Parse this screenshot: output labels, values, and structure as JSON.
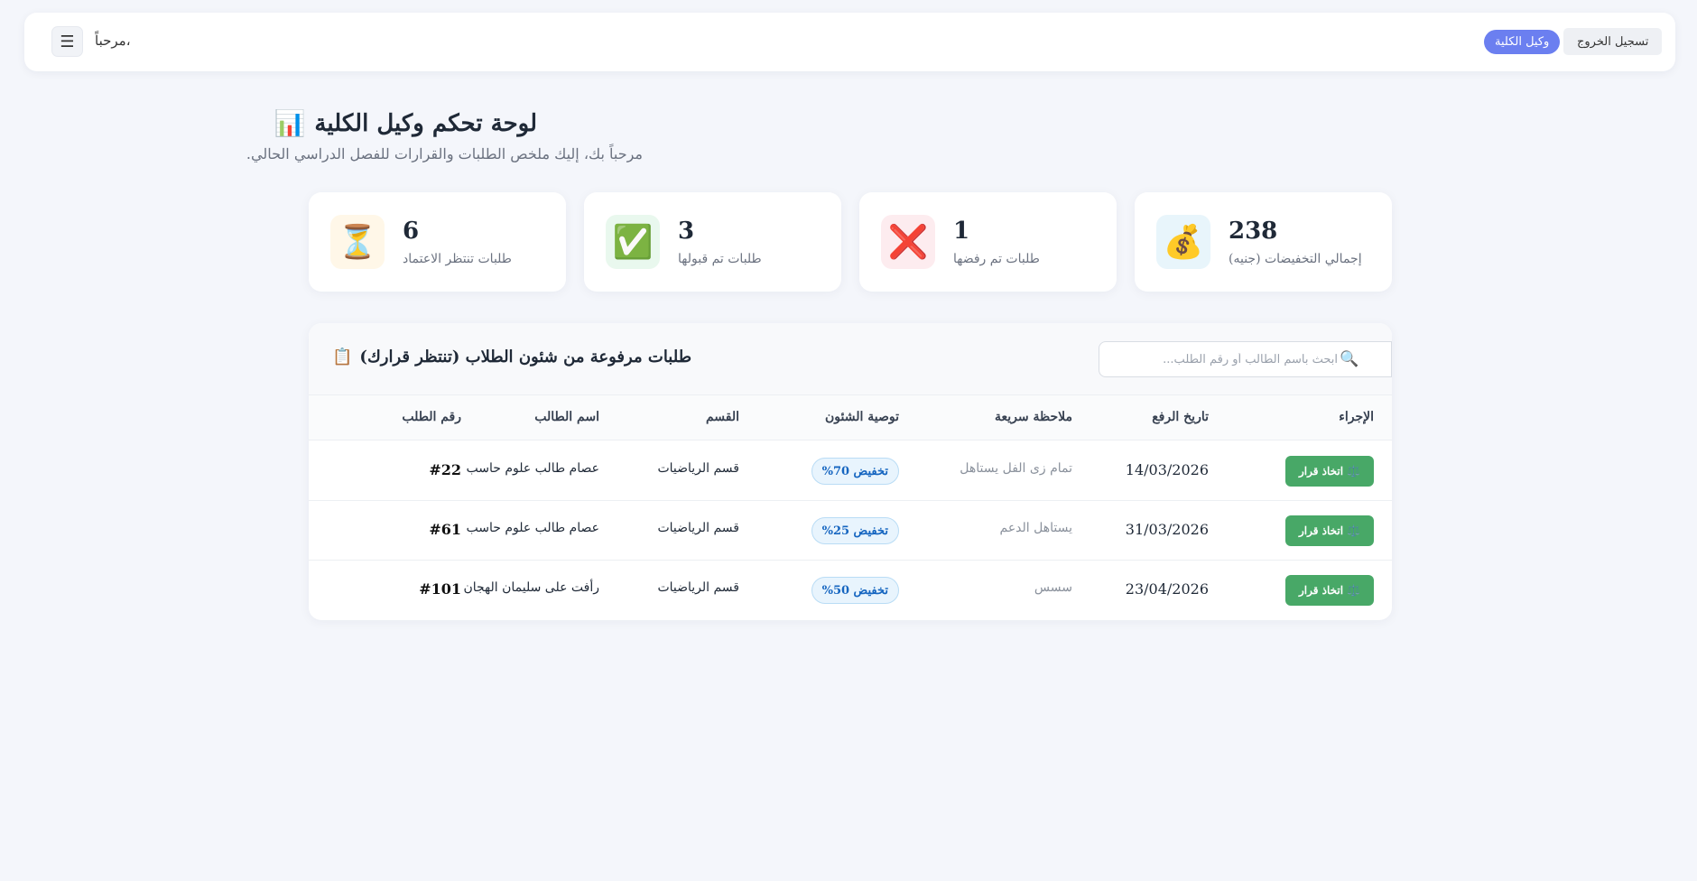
{
  "header": {
    "menu_icon": "menu-icon",
    "menu_glyph": "☰",
    "greeting": "مرحباً،",
    "role_badge": "وكيل الكلية",
    "logout_label": "تسجيل الخروج"
  },
  "page": {
    "title": "لوحة تحكم وكيل الكلية",
    "title_icon": "📊",
    "subtitle": "مرحباً بك، إليك ملخص الطلبات والقرارات للفصل الدراسي الحالي."
  },
  "stats": [
    {
      "icon": "⏳",
      "icon_name": "hourglass-icon",
      "value": "6",
      "label": "طلبات تنتظر الاعتماد",
      "bg": "#fff7e8"
    },
    {
      "icon": "✅",
      "icon_name": "check-icon",
      "value": "3",
      "label": "طلبات تم قبولها",
      "bg": "#e9f8ee"
    },
    {
      "icon": "❌",
      "icon_name": "cross-icon",
      "value": "1",
      "label": "طلبات تم رفضها",
      "bg": "#fdecef"
    },
    {
      "icon": "💰",
      "icon_name": "money-bag-icon",
      "value": "238",
      "label": "إجمالي التخفيضات (جنيه)",
      "bg": "#e8f5fb"
    }
  ],
  "panel": {
    "title": "طلبات مرفوعة من شئون الطلاب (تنتظر قرارك)",
    "title_icon": "📋",
    "search_placeholder": "ابحث باسم الطالب أو رقم الطلب...",
    "search_icon": "🔍"
  },
  "table": {
    "columns": {
      "id": "رقم الطلب",
      "name": "اسم الطالب",
      "dept": "القسم",
      "rec": "توصية الشئون",
      "note": "ملاحظة سريعة",
      "date": "تاريخ الرفع",
      "action": "الإجراء"
    },
    "action_label": "اتخاذ قرار",
    "action_icon": "⚖️",
    "rows": [
      {
        "id": "#22",
        "name": "عصام طالب علوم حاسب",
        "dept": "قسم الرياضيات",
        "rec": "تخفيض 70%",
        "note": "تمام زى الفل يستاهل",
        "date": "14/03/2026"
      },
      {
        "id": "#61",
        "name": "عصام طالب علوم حاسب",
        "dept": "قسم الرياضيات",
        "rec": "تخفيض 25%",
        "note": "يستاهل الدعم",
        "date": "31/03/2026"
      },
      {
        "id": "#101",
        "name": "رأفت على سليمان الهجان",
        "dept": "قسم الرياضيات",
        "rec": "تخفيض 50%",
        "note": "سسس",
        "date": "23/04/2026"
      }
    ]
  }
}
